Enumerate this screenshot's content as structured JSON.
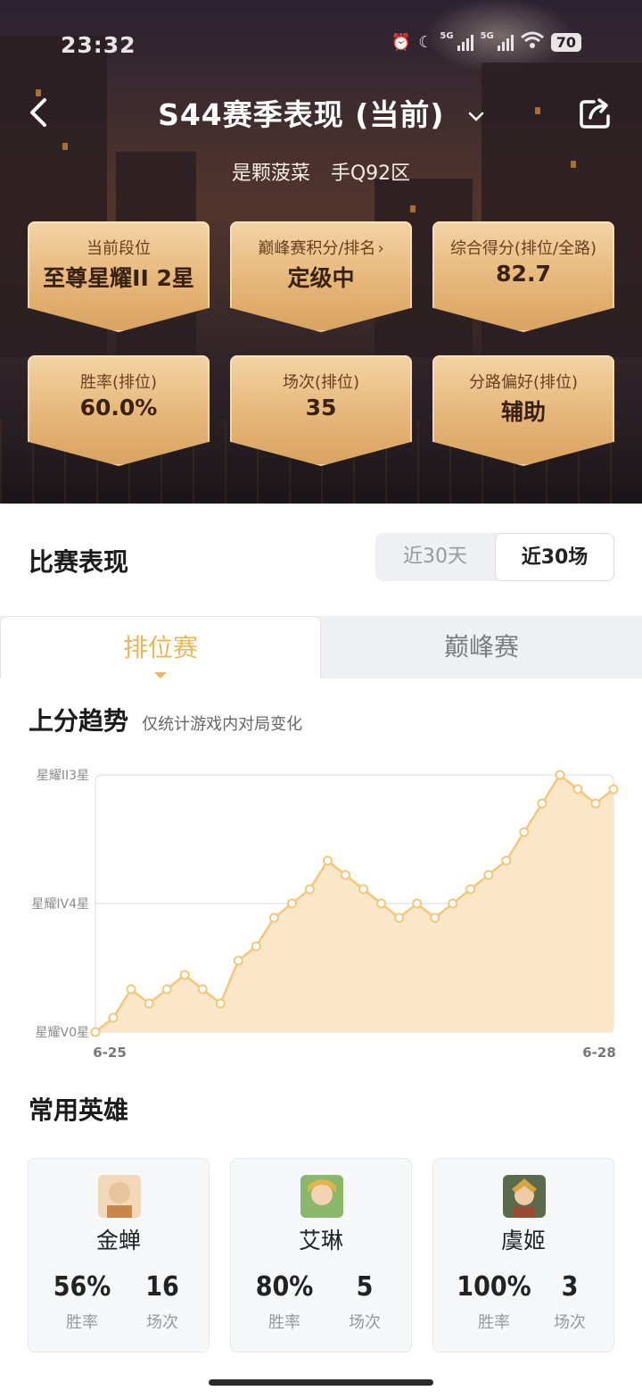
{
  "status_bar": {
    "time": "23:32",
    "net1": "5G",
    "net2": "5G",
    "battery": "70"
  },
  "nav": {
    "title": "S44赛季表现 (当前)"
  },
  "player": {
    "name": "是颗菠菜",
    "server": "手Q92区"
  },
  "stats": [
    {
      "label": "当前段位",
      "value": "至尊星耀II 2星"
    },
    {
      "label": "巅峰赛积分/排名",
      "value": "定级中"
    },
    {
      "label": "综合得分(排位/全路)",
      "value": "82.7"
    },
    {
      "label": "胜率(排位)",
      "value": "60.0%"
    },
    {
      "label": "场次(排位)",
      "value": "35"
    },
    {
      "label": "分路偏好(排位)",
      "value": "辅助"
    }
  ],
  "performance": {
    "title": "比赛表现",
    "range_options": [
      "近30天",
      "近30场"
    ],
    "selected_range": "近30场"
  },
  "tabs": {
    "ranked": "排位赛",
    "peak": "巅峰赛",
    "active": "排位赛"
  },
  "trend": {
    "title": "上分趋势",
    "note": "仅统计游戏内对局变化"
  },
  "chart_data": {
    "type": "area",
    "y_tick_labels": [
      "星耀V0星",
      "星耀IV4星",
      "星耀II3星"
    ],
    "x_tick_labels": [
      "6-25",
      "6-28"
    ],
    "x": [
      1,
      2,
      3,
      4,
      5,
      6,
      7,
      8,
      9,
      10,
      11,
      12,
      13,
      14,
      15,
      16,
      17,
      18,
      19,
      20,
      21,
      22,
      23,
      24,
      25,
      26,
      27,
      28,
      29,
      30
    ],
    "values": [
      0,
      1,
      3,
      2,
      3,
      4,
      3,
      2,
      5,
      6,
      8,
      9,
      10,
      12,
      11,
      10,
      9,
      8,
      9,
      8,
      9,
      10,
      11,
      12,
      14,
      16,
      18,
      17,
      16,
      17
    ],
    "ylim": [
      0,
      18
    ],
    "grid": "y-major",
    "accent_color": "#f3c77a",
    "fill_color": "#fbe7c8"
  },
  "heroes": {
    "title": "常用英雄",
    "win_rate_label": "胜率",
    "games_label": "场次",
    "items": [
      {
        "name": "金蝉",
        "win_rate": "56%",
        "games": "16",
        "avatar_icon": "jinchan-avatar-icon"
      },
      {
        "name": "艾琳",
        "win_rate": "80%",
        "games": "5",
        "avatar_icon": "ailin-avatar-icon"
      },
      {
        "name": "虞姬",
        "win_rate": "100%",
        "games": "3",
        "avatar_icon": "yuji-avatar-icon"
      }
    ]
  },
  "colors": {
    "accent": "#e8b75c",
    "card_gold": "#e6b679"
  }
}
